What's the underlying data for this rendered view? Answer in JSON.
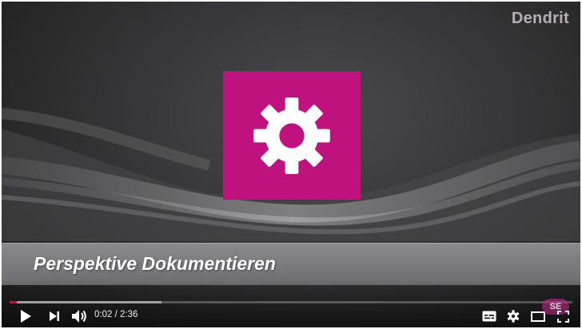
{
  "brand": {
    "label": "Dendrit"
  },
  "slide": {
    "tile_color": "#c0127f",
    "icon": "gear-icon"
  },
  "title": {
    "text": "Perspektive Dokumentieren"
  },
  "player": {
    "time_current": "0:02",
    "time_total": "2:36",
    "time_display": "0:02 / 2:36",
    "progress_played": 0.013,
    "progress_loaded": 0.27,
    "progress_color": "#e1002d",
    "watermark": "SE"
  },
  "controls": {
    "play": "play-icon",
    "next": "next-icon",
    "volume": "volume-icon",
    "captions": "captions-icon",
    "settings": "gear-icon",
    "theater": "theater-mode-icon",
    "fullscreen": "fullscreen-icon"
  }
}
